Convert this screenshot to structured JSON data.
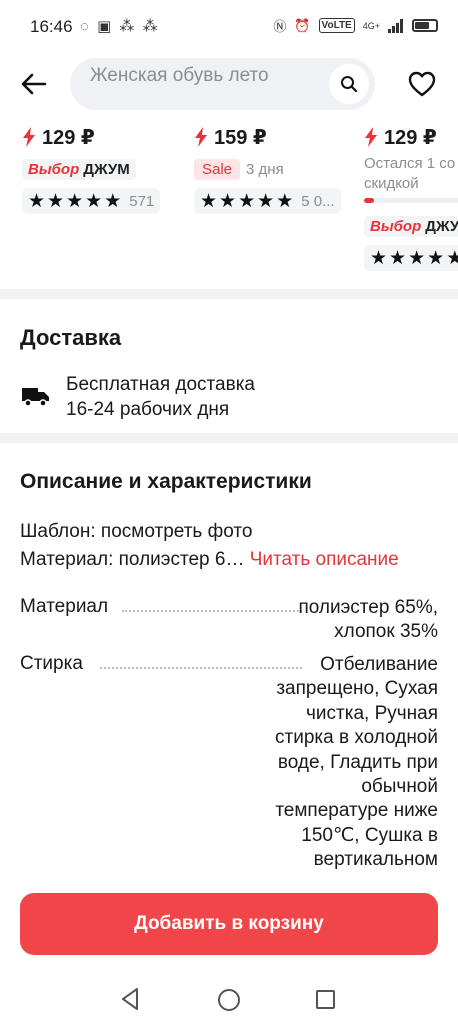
{
  "status_bar": {
    "time": "16:46",
    "left_icons": "◌ ▣ ⁂ ⁂",
    "volte": "VoLTE",
    "network": "4G+"
  },
  "header": {
    "search_text": "Женская обувь лето"
  },
  "products": [
    {
      "price": "129 ₽",
      "badge_vybor": "Выбор",
      "badge_djum": "ДЖУМ",
      "rating_count": "571"
    },
    {
      "price": "159 ₽",
      "sale": "Sale",
      "days": "3 дня",
      "rating_count": "5 0..."
    },
    {
      "price": "129 ₽",
      "stock_line1": "Остался 1 со",
      "stock_line2": "скидкой",
      "stock_progress": 0.08,
      "badge_vybor": "Выбор",
      "badge_djum": "ДЖУМ"
    }
  ],
  "delivery": {
    "title": "Доставка",
    "line1": "Бесплатная доставка",
    "line2": "16-24 рабочих дня"
  },
  "description": {
    "title": "Описание и характеристики",
    "template_line": "Шаблон: посмотреть фото",
    "material_line": "Материал: полиэстер 6…",
    "read_more": "Читать описание",
    "specs": [
      {
        "name": "Материал",
        "value_lines": [
          "полиэстер 65%,",
          "хлопок 35%"
        ]
      },
      {
        "name": "Стирка",
        "value_lines": [
          "Отбеливание",
          "запрещено, Сухая",
          "чистка, Ручная",
          "стирка в холодной",
          "воде, Гладить при",
          "обычной",
          "температуре ниже",
          "150℃, Сушка в",
          "вертикальном"
        ]
      }
    ]
  },
  "cart_button": "Добавить в корзину",
  "colors": {
    "accent": "#f04649",
    "brand_red": "#e8333c",
    "muted": "#8a8d95",
    "divider": "#f1f2f4"
  }
}
